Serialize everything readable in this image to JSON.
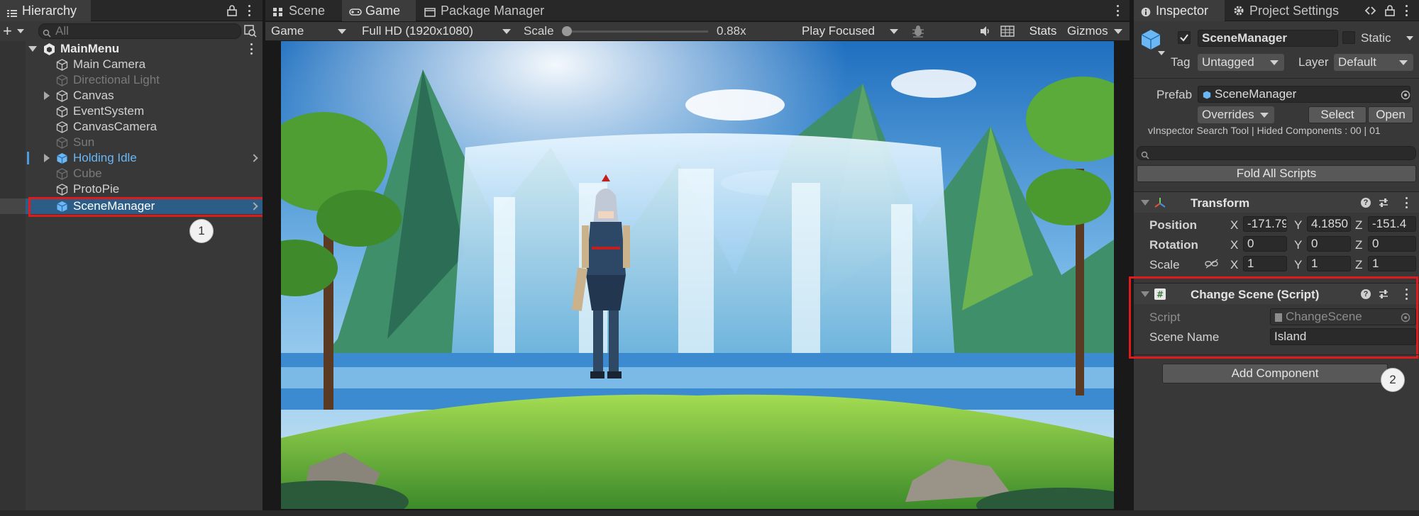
{
  "hierarchy": {
    "tab_label": "Hierarchy",
    "search_placeholder": "All",
    "add_label": "+",
    "root": "MainMenu",
    "items": [
      {
        "label": "Main Camera"
      },
      {
        "label": "Directional Light"
      },
      {
        "label": "Canvas"
      },
      {
        "label": "EventSystem"
      },
      {
        "label": "CanvasCamera"
      },
      {
        "label": "Sun"
      },
      {
        "label": "Holding Idle"
      },
      {
        "label": "Cube"
      },
      {
        "label": "ProtoPie"
      },
      {
        "label": "SceneManager"
      }
    ]
  },
  "center": {
    "tabs": [
      {
        "label": "Scene"
      },
      {
        "label": "Game"
      },
      {
        "label": "Package Manager"
      }
    ],
    "toolbar": {
      "display": "Game",
      "resolution": "Full HD (1920x1080)",
      "scale_label": "Scale",
      "scale_value": "0.88x",
      "scale_fraction": 0.0,
      "play_mode": "Play Focused",
      "stats": "Stats",
      "gizmos": "Gizmos"
    }
  },
  "inspector": {
    "tabs": [
      {
        "label": "Inspector"
      },
      {
        "label": "Project Settings"
      }
    ],
    "object_name": "SceneManager",
    "static_label": "Static",
    "tag_label": "Tag",
    "tag_value": "Untagged",
    "layer_label": "Layer",
    "layer_value": "Default",
    "prefab_label": "Prefab",
    "prefab_value": "SceneManager",
    "overrides_label": "Overrides",
    "select_label": "Select",
    "open_label": "Open",
    "vinspector_text": "vInspector Search Tool | Hided Components : 00 | 01",
    "fold_all_label": "Fold All Scripts",
    "transform": {
      "title": "Transform",
      "position_label": "Position",
      "rotation_label": "Rotation",
      "scale_label": "Scale",
      "x_label": "X",
      "y_label": "Y",
      "z_label": "Z",
      "position": {
        "x": "-171.79",
        "y": "4.1850",
        "z": "-151.4"
      },
      "rotation": {
        "x": "0",
        "y": "0",
        "z": "0"
      },
      "scale": {
        "x": "1",
        "y": "1",
        "z": "1"
      }
    },
    "change_scene": {
      "title": "Change Scene (Script)",
      "script_label": "Script",
      "script_value": "ChangeScene",
      "scene_name_label": "Scene Name",
      "scene_name_value": "Island"
    },
    "add_component_label": "Add Component"
  },
  "annotations": {
    "badge1": "1",
    "badge2": "2"
  },
  "colors": {
    "highlight": "#e01b1b",
    "selection": "#2c5d87",
    "panel_bg": "#383838",
    "blue_text": "#6ab7f5"
  }
}
